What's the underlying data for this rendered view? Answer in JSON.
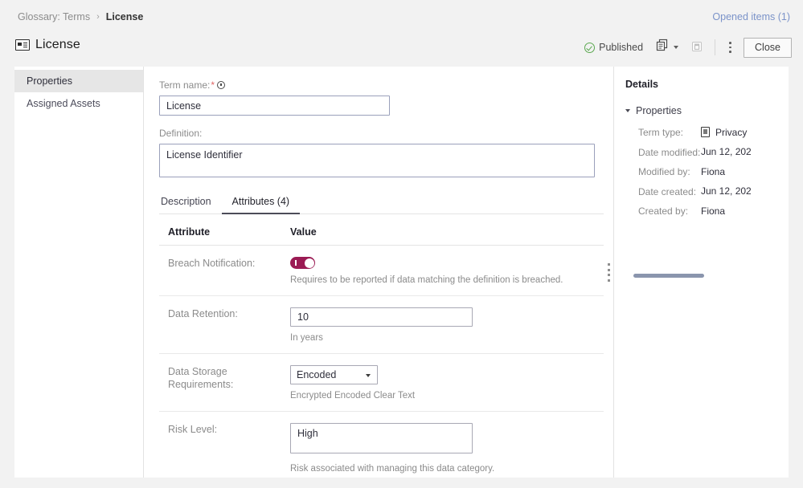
{
  "breadcrumb": {
    "root": "Glossary: Terms",
    "separator": "›",
    "current": "License"
  },
  "header": {
    "opened_items": "Opened items (1)",
    "title": "License",
    "title_icon": "term-card-icon",
    "status": "Published",
    "status_icon": "check-circle-icon",
    "status_color": "#5aa84f",
    "copy_icon": "copy-icon",
    "delete_icon": "trash-icon",
    "more_icon": "kebab-menu-icon",
    "close_label": "Close"
  },
  "sidebar": {
    "items": [
      {
        "label": "Properties",
        "active": true
      },
      {
        "label": "Assigned Assets",
        "active": false
      }
    ]
  },
  "form": {
    "term_name_label": "Term name:",
    "term_name_required": "*",
    "term_name_value": "License",
    "term_name_placeholder": "Term name",
    "definition_label": "Definition:",
    "definition_value": "License Identifier",
    "definition_placeholder": "Definition"
  },
  "tabs": [
    {
      "label": "Description",
      "active": false
    },
    {
      "label": "Attributes (4)",
      "active": true
    }
  ],
  "attributes_table": {
    "columns": [
      "Attribute",
      "Value"
    ],
    "rows": [
      {
        "name": "Breach Notification:",
        "type": "toggle",
        "value": "on",
        "helper": "Requires to be reported if data matching the definition is breached.",
        "accent": "#9b1b54"
      },
      {
        "name": "Data Retention:",
        "type": "text",
        "value": "10",
        "helper": "In years"
      },
      {
        "name": "Data Storage Requirements:",
        "type": "select",
        "value": "Encoded",
        "options": [
          "Encrypted",
          "Encoded",
          "Clear Text"
        ],
        "helper": "Encrypted Encoded Clear Text"
      },
      {
        "name": "Risk Level:",
        "type": "textarea",
        "value": "High",
        "helper": "Risk associated with managing this data category."
      }
    ]
  },
  "details": {
    "title": "Details",
    "section_label": "Properties",
    "properties": [
      {
        "key": "Term type:",
        "value": "Privacy",
        "icon": "privacy-doc-icon"
      },
      {
        "key": "Date modified:",
        "value": "Jun 12, 202"
      },
      {
        "key": "Modified by:",
        "value": "Fiona"
      },
      {
        "key": "Date created:",
        "value": "Jun 12, 202"
      },
      {
        "key": "Created by:",
        "value": "Fiona"
      }
    ]
  }
}
